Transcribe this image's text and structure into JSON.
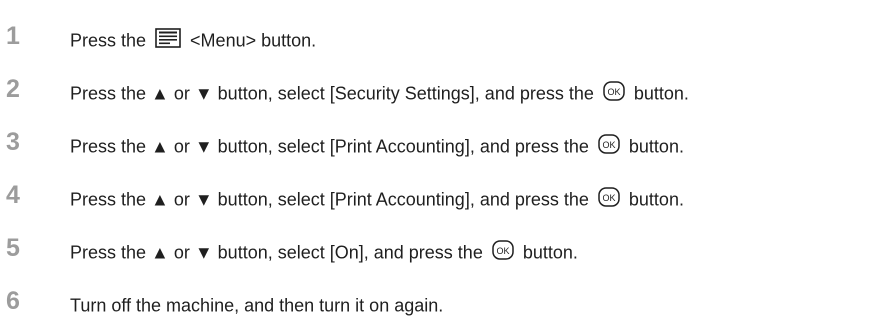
{
  "steps": [
    {
      "number": "1",
      "parts": [
        "Press the ",
        "menu-icon",
        " <Menu> button."
      ]
    },
    {
      "number": "2",
      "parts": [
        "Press the ▲ or ▼ button, select [Security Settings], and press the ",
        "ok-icon",
        " button."
      ]
    },
    {
      "number": "3",
      "parts": [
        "Press the ▲ or ▼ button, select [Print Accounting], and press the ",
        "ok-icon",
        " button."
      ]
    },
    {
      "number": "4",
      "parts": [
        "Press the ▲ or ▼ button, select [Print Accounting], and press the ",
        "ok-icon",
        " button."
      ]
    },
    {
      "number": "5",
      "parts": [
        "Press the ▲ or ▼ button, select [On], and press the ",
        "ok-icon",
        " button."
      ]
    },
    {
      "number": "6",
      "parts": [
        "Turn off the machine, and then turn it on again."
      ]
    }
  ],
  "icons": {
    "ok_label": "OK"
  },
  "colors": {
    "step_number": "#9c9c9c",
    "text": "#1f1f1f"
  }
}
